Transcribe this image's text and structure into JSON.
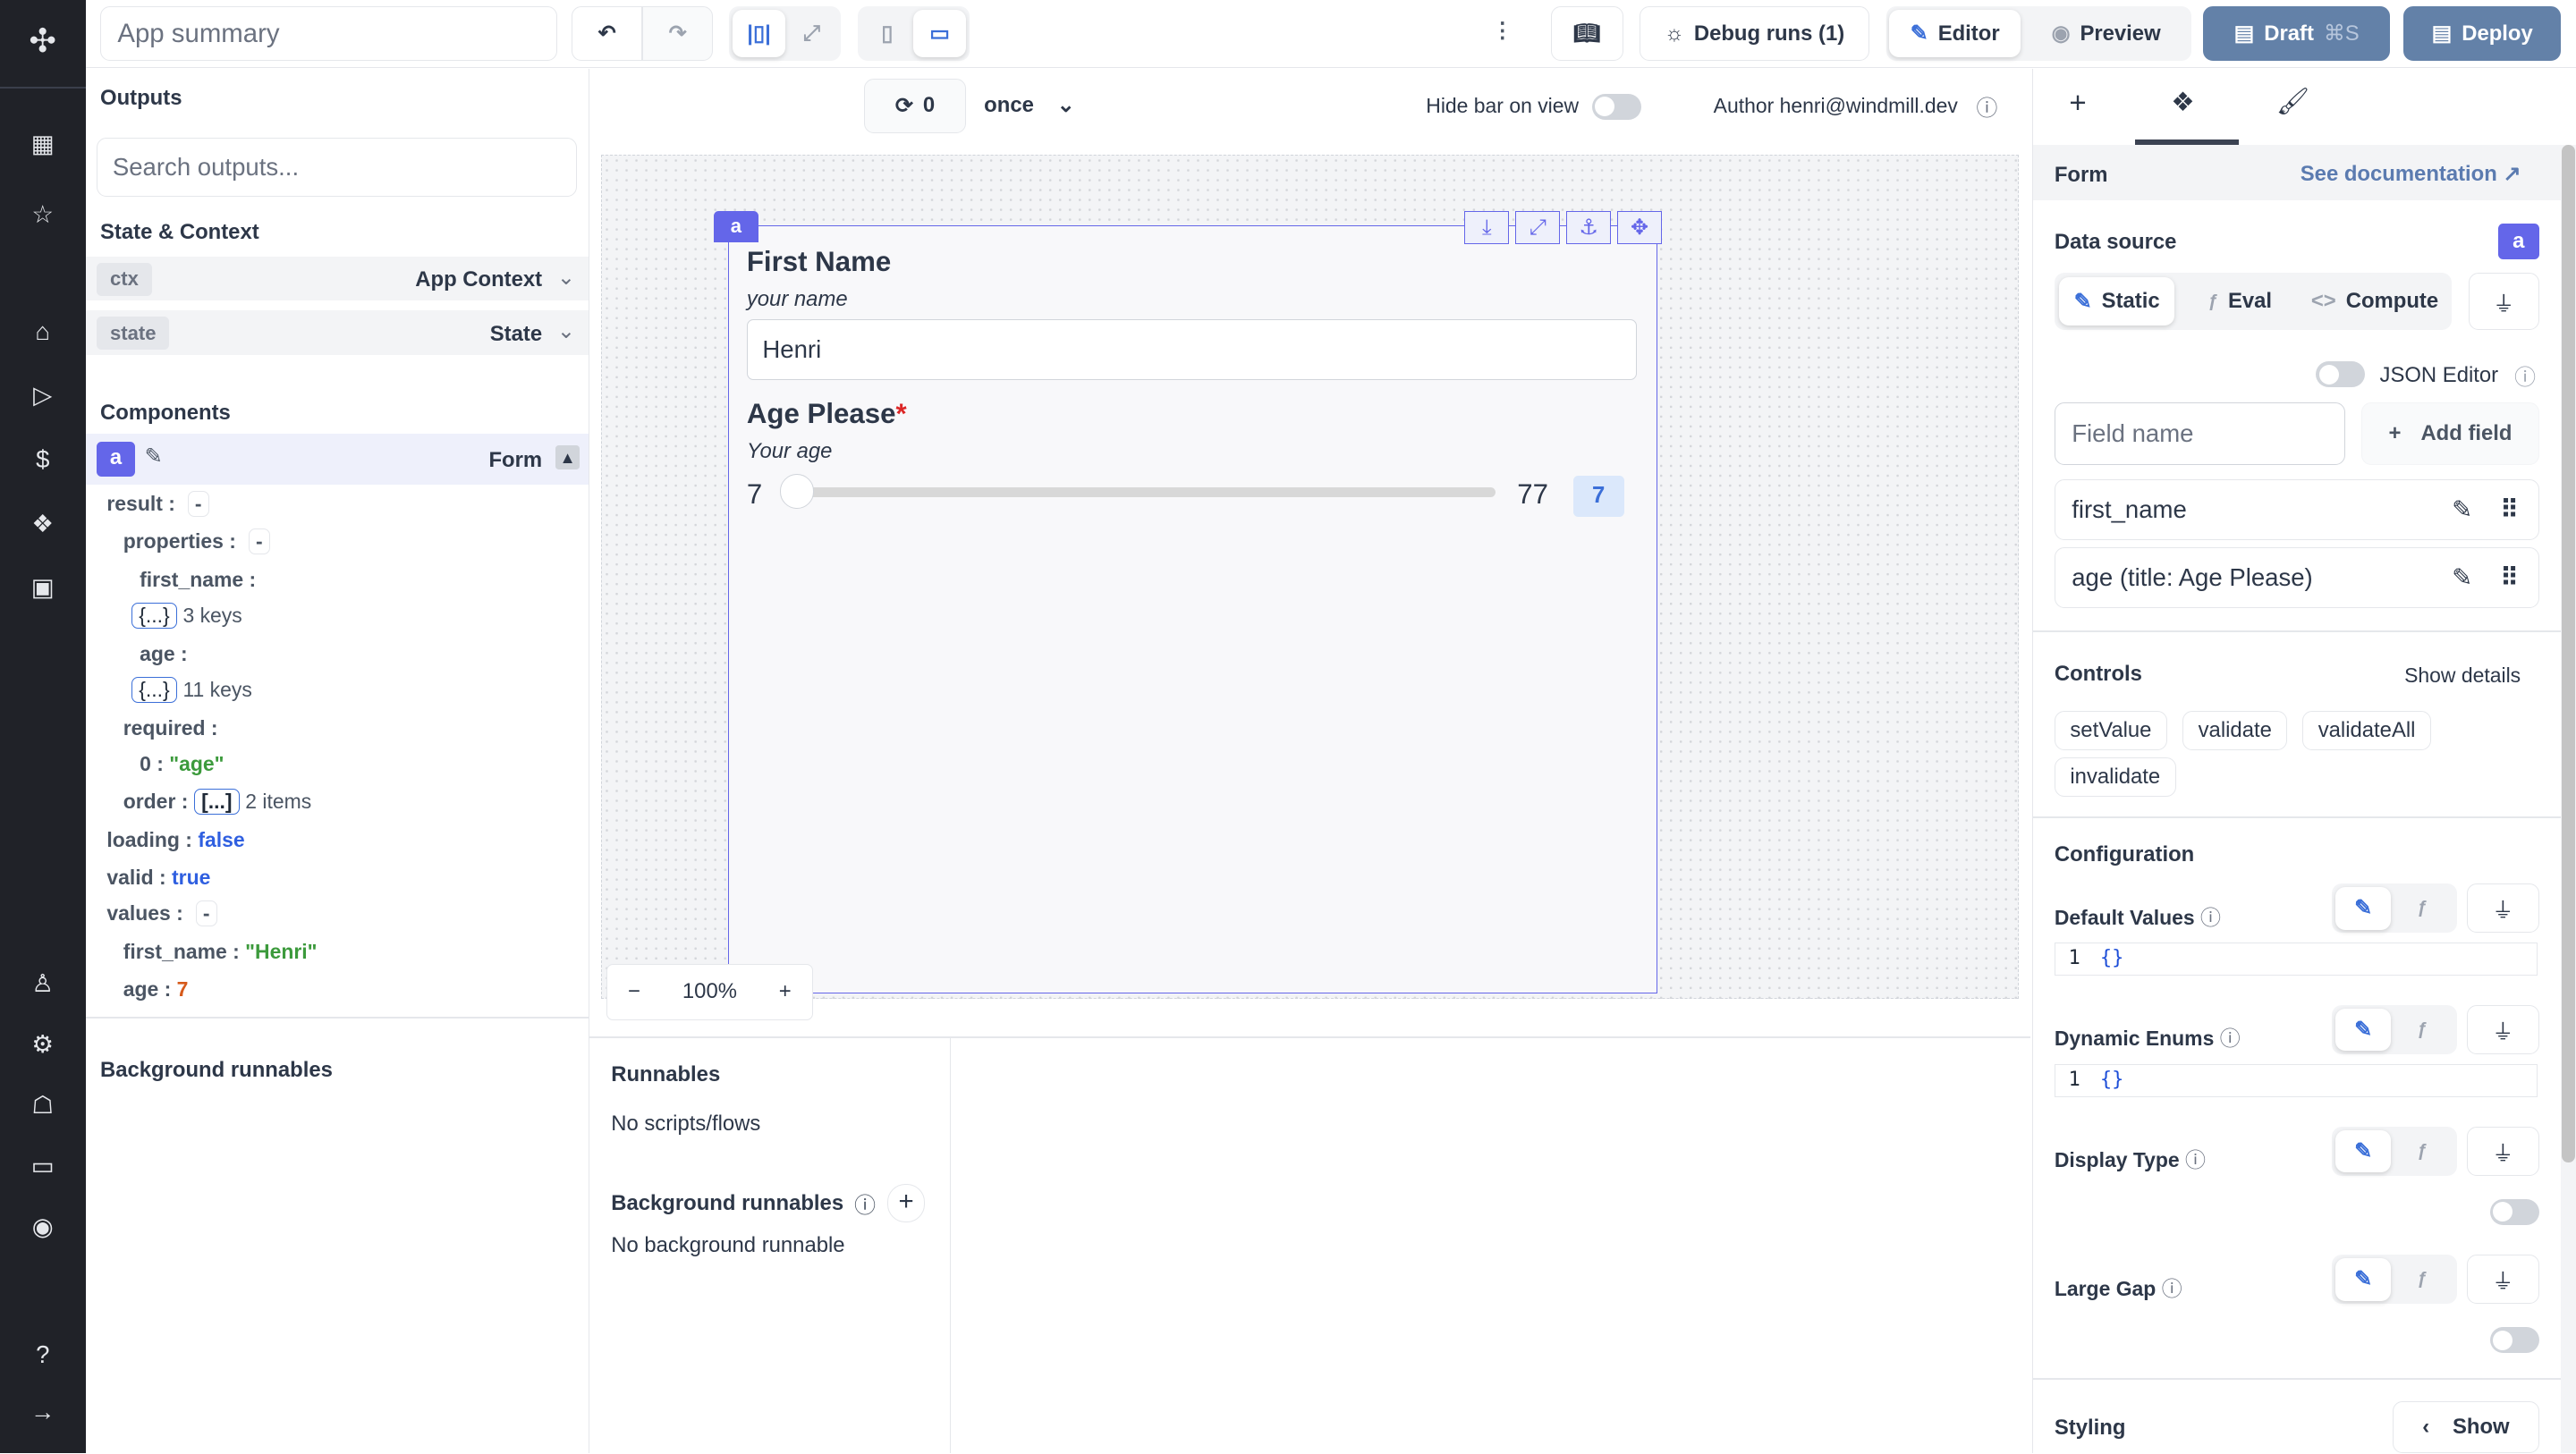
{
  "header": {
    "app_title": "App summary",
    "debug_runs": "Debug runs (1)",
    "editor": "Editor",
    "preview": "Preview",
    "draft": "Draft",
    "draft_shortcut": "⌘S",
    "deploy": "Deploy"
  },
  "toolbar": {
    "refresh_count": "0",
    "refresh_mode": "once",
    "hide_bar_label": "Hide bar on view",
    "author": "Author henri@windmill.dev",
    "zoom": "100%"
  },
  "left": {
    "outputs_title": "Outputs",
    "search_placeholder": "Search outputs...",
    "state_title": "State & Context",
    "ctx_chip": "ctx",
    "ctx_label": "App Context",
    "state_chip": "state",
    "state_label": "State",
    "components_title": "Components",
    "component_id": "a",
    "component_type": "Form",
    "tree": {
      "result": "result",
      "properties": "properties",
      "first_name": "first_name",
      "obj": "{...}",
      "fn_keys": "3 keys",
      "age": "age",
      "age_keys": "11 keys",
      "required": "required",
      "req0_key": "0",
      "req0_val": "\"age\"",
      "order": "order",
      "arr": "[...]",
      "order_items": "2 items",
      "loading": "loading",
      "loading_val": "false",
      "valid": "valid",
      "valid_val": "true",
      "values": "values",
      "v_first_name": "first_name",
      "v_first_name_val": "\"Henri\"",
      "v_age": "age",
      "v_age_val": "7",
      "collapse": "-",
      "colon": ":"
    },
    "bg_runnables_title": "Background runnables"
  },
  "form": {
    "id": "a",
    "field1_label": "First Name",
    "field1_desc": "your name",
    "field1_value": "Henri",
    "field2_label": "Age Please",
    "required_mark": "*",
    "field2_desc": "Your age",
    "slider_min": "7",
    "slider_max": "77",
    "slider_value": "7",
    "slider_fraction": 0
  },
  "runnables": {
    "title": "Runnables",
    "empty": "No scripts/flows",
    "bg_title": "Background runnables",
    "bg_empty": "No background runnable"
  },
  "right": {
    "section": "Form",
    "docs": "See documentation",
    "data_source": "Data source",
    "ds_badge": "a",
    "static": "Static",
    "eval": "Eval",
    "compute": "Compute",
    "json_editor": "JSON Editor",
    "field_placeholder": "Field name",
    "add_field": "Add field",
    "fields": [
      "first_name",
      "age (title: Age Please)"
    ],
    "controls": "Controls",
    "show_details": "Show details",
    "control_items": [
      "setValue",
      "validate",
      "validateAll",
      "invalidate"
    ],
    "configuration": "Configuration",
    "default_values": "Default Values",
    "dynamic_enums": "Dynamic Enums",
    "display_type": "Display Type",
    "large_gap": "Large Gap",
    "line_no": "1",
    "empty_obj": "{}",
    "styling": "Styling",
    "show": "Show"
  },
  "colors": {
    "accent": "#6466e9",
    "nav_bg": "#202228",
    "deploy": "#6381a8",
    "blue": "#3b6fd8"
  }
}
